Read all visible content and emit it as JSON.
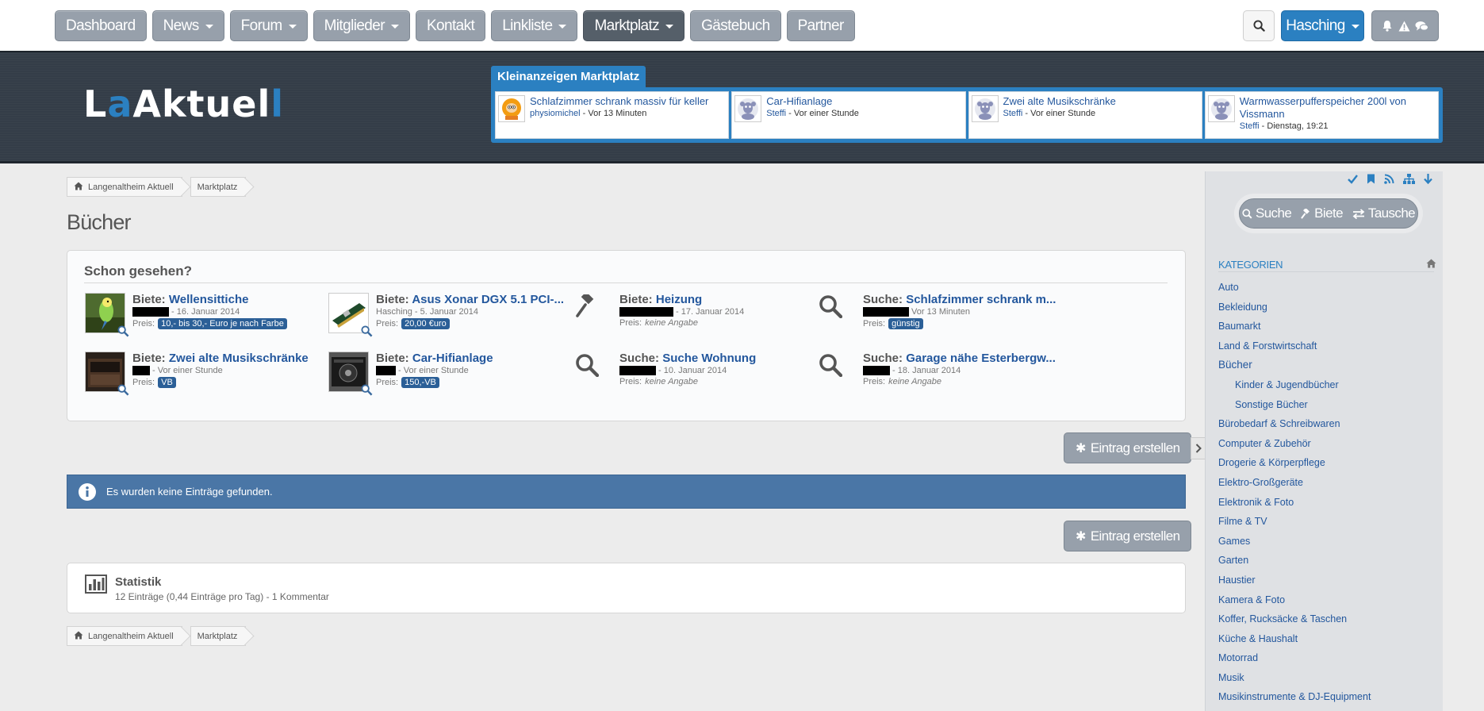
{
  "nav": {
    "items": [
      {
        "label": "Dashboard",
        "dropdown": false
      },
      {
        "label": "News",
        "dropdown": true
      },
      {
        "label": "Forum",
        "dropdown": true
      },
      {
        "label": "Mitglieder",
        "dropdown": true
      },
      {
        "label": "Kontakt",
        "dropdown": false
      },
      {
        "label": "Linkliste",
        "dropdown": true
      },
      {
        "label": "Marktplatz",
        "dropdown": true,
        "active": true
      },
      {
        "label": "Gästebuch",
        "dropdown": false
      },
      {
        "label": "Partner",
        "dropdown": false
      }
    ],
    "user": "Hasching",
    "icons": [
      "search-icon",
      "bell-icon",
      "warning-icon",
      "chat-icon"
    ]
  },
  "header": {
    "logo": {
      "part1": "L",
      "accent1": "a",
      "part2": "Aktuel",
      "accent2": "l"
    },
    "market_label": "Kleinanzeigen Marktplatz",
    "market_items": [
      {
        "title": "Schlafzimmer schrank massiv für keller",
        "user": "physiomichel",
        "time": "Vor 13 Minuten",
        "avatar": "kenny-avatar"
      },
      {
        "title": "Car-Hifianlage",
        "user": "Steffi",
        "time": "Vor einer Stunde",
        "avatar": "default-avatar"
      },
      {
        "title": "Zwei alte Musikschränke",
        "user": "Steffi",
        "time": "Vor einer Stunde",
        "avatar": "default-avatar"
      },
      {
        "title": "Warmwasserpufferspeicher 200l von Vissmann",
        "user": "Steffi",
        "time": "Dienstag, 19:21",
        "avatar": "default-avatar"
      }
    ]
  },
  "breadcrumb": [
    "Langenaltheim Aktuell",
    "Marktplatz"
  ],
  "page_title": "Bücher",
  "seen": {
    "title": "Schon gesehen?",
    "price_label": "Preis:",
    "items": [
      {
        "type": "Biete:",
        "title": "Wellensittiche",
        "user": "",
        "date": "16. Januar 2014",
        "price": "10,- bis 30,- Euro je nach Farbe",
        "thumb": "budgie"
      },
      {
        "type": "Biete:",
        "title": "Asus Xonar DGX 5.1 PCI-...",
        "user": "Hasching",
        "date": "5. Januar 2014",
        "price": "20,00 €uro",
        "thumb": "soundcard"
      },
      {
        "type": "Biete:",
        "title": "Heizung",
        "user": "",
        "date": "17. Januar 2014",
        "price": "",
        "price_none": "keine Angabe",
        "thumb": "gavel-icon"
      },
      {
        "type": "Suche:",
        "title": "Schlafzimmer schrank m...",
        "user": "",
        "date": "Vor 13 Minuten",
        "price": "günstig",
        "thumb": "magnifier-icon"
      },
      {
        "type": "Biete:",
        "title": "Zwei alte Musikschränke",
        "user": "",
        "date": "Vor einer Stunde",
        "price": "VB",
        "thumb": "cabinet"
      },
      {
        "type": "Biete:",
        "title": "Car-Hifianlage",
        "user": "",
        "date": "Vor einer Stunde",
        "price": "150,-VB",
        "thumb": "hifi"
      },
      {
        "type": "Suche:",
        "title": "Suche Wohnung",
        "user": "",
        "date": "10. Januar 2014",
        "price": "",
        "price_none": "keine Angabe",
        "thumb": "magnifier-icon"
      },
      {
        "type": "Suche:",
        "title": "Garage nähe Esterbergw...",
        "user": "",
        "date": "18. Januar 2014",
        "price": "",
        "price_none": "keine Angabe",
        "thumb": "magnifier-icon"
      }
    ]
  },
  "create_label": "Eintrag erstellen",
  "no_entries": "Es wurden keine Einträge gefunden.",
  "statistik": {
    "title": "Statistik",
    "text": "12 Einträge (0,44 Einträge pro Tag) - 1 Kommentar"
  },
  "sidebar": {
    "tabs": [
      "Suche",
      "Biete",
      "Tausche"
    ],
    "categories_title": "KATEGORIEN",
    "categories": [
      {
        "label": "Auto"
      },
      {
        "label": "Bekleidung"
      },
      {
        "label": "Baumarkt"
      },
      {
        "label": "Land & Forstwirtschaft"
      },
      {
        "label": "Bücher",
        "active": true
      },
      {
        "label": "Kinder & Jugendbücher",
        "sub": true
      },
      {
        "label": "Sonstige Bücher",
        "sub": true
      },
      {
        "label": "Bürobedarf & Schreibwaren"
      },
      {
        "label": "Computer & Zubehör"
      },
      {
        "label": "Drogerie & Körperpflege"
      },
      {
        "label": "Elektro-Großgeräte"
      },
      {
        "label": "Elektronik & Foto"
      },
      {
        "label": "Filme & TV"
      },
      {
        "label": "Games"
      },
      {
        "label": "Garten"
      },
      {
        "label": "Haustier"
      },
      {
        "label": "Kamera & Foto"
      },
      {
        "label": "Koffer, Rucksäcke & Taschen"
      },
      {
        "label": "Küche & Haushalt"
      },
      {
        "label": "Motorrad"
      },
      {
        "label": "Musik"
      },
      {
        "label": "Musikinstrumente & DJ-Equipment"
      }
    ]
  }
}
